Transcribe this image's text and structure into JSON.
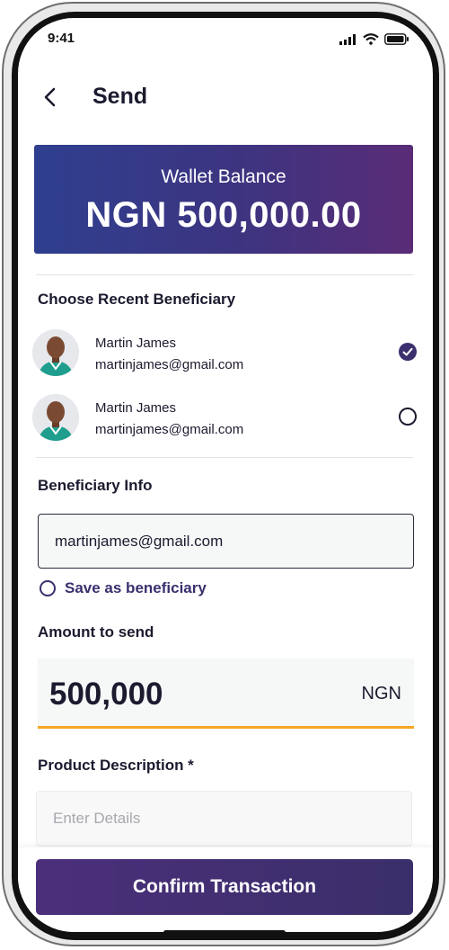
{
  "status_bar": {
    "time": "9:41"
  },
  "header": {
    "title": "Send"
  },
  "wallet": {
    "label": "Wallet Balance",
    "amount": "NGN 500,000.00"
  },
  "recent": {
    "title": "Choose Recent Beneficiary",
    "items": [
      {
        "name": "Martin James",
        "email": "martinjames@gmail.com",
        "selected": true
      },
      {
        "name": "Martin James",
        "email": "martinjames@gmail.com",
        "selected": false
      }
    ]
  },
  "beneficiary_info": {
    "title": "Beneficiary Info",
    "value": "martinjames@gmail.com",
    "save_label": "Save as beneficiary"
  },
  "amount": {
    "title": "Amount to send",
    "value": "500,000",
    "currency": "NGN"
  },
  "description": {
    "title": "Product Description *",
    "placeholder": "Enter Details"
  },
  "confirm_label": "Confirm Transaction",
  "colors": {
    "primary": "#3b2f6e",
    "accent": "#f5a623",
    "wallet_start": "#2f3f8f",
    "wallet_end": "#5a2c77"
  }
}
